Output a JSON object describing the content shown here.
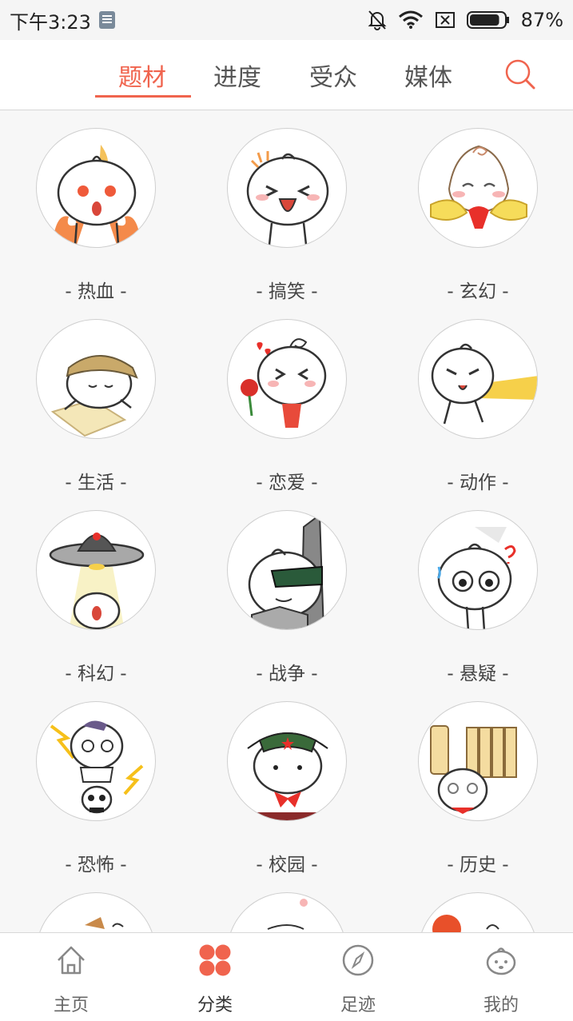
{
  "status_bar": {
    "time": "下午3:23",
    "battery": "87%",
    "battery_level": 0.87
  },
  "top_tabs": {
    "items": [
      {
        "label": "题材",
        "active": true
      },
      {
        "label": "进度",
        "active": false
      },
      {
        "label": "受众",
        "active": false
      },
      {
        "label": "媒体",
        "active": false
      }
    ],
    "search_icon": "search-icon",
    "accent_color": "#f0644e"
  },
  "categories": [
    {
      "label": "- 热血 -"
    },
    {
      "label": "- 搞笑 -"
    },
    {
      "label": "- 玄幻 -"
    },
    {
      "label": "- 生活 -"
    },
    {
      "label": "- 恋爱 -"
    },
    {
      "label": "- 动作 -"
    },
    {
      "label": "- 科幻 -"
    },
    {
      "label": "- 战争 -"
    },
    {
      "label": "- 悬疑 -"
    },
    {
      "label": "- 恐怖 -"
    },
    {
      "label": "- 校园 -"
    },
    {
      "label": "- 历史 -"
    }
  ],
  "bottom_nav": {
    "items": [
      {
        "label": "主页",
        "icon": "home-icon",
        "active": false
      },
      {
        "label": "分类",
        "icon": "category-icon",
        "active": true
      },
      {
        "label": "足迹",
        "icon": "compass-icon",
        "active": false
      },
      {
        "label": "我的",
        "icon": "profile-icon",
        "active": false
      }
    ]
  }
}
